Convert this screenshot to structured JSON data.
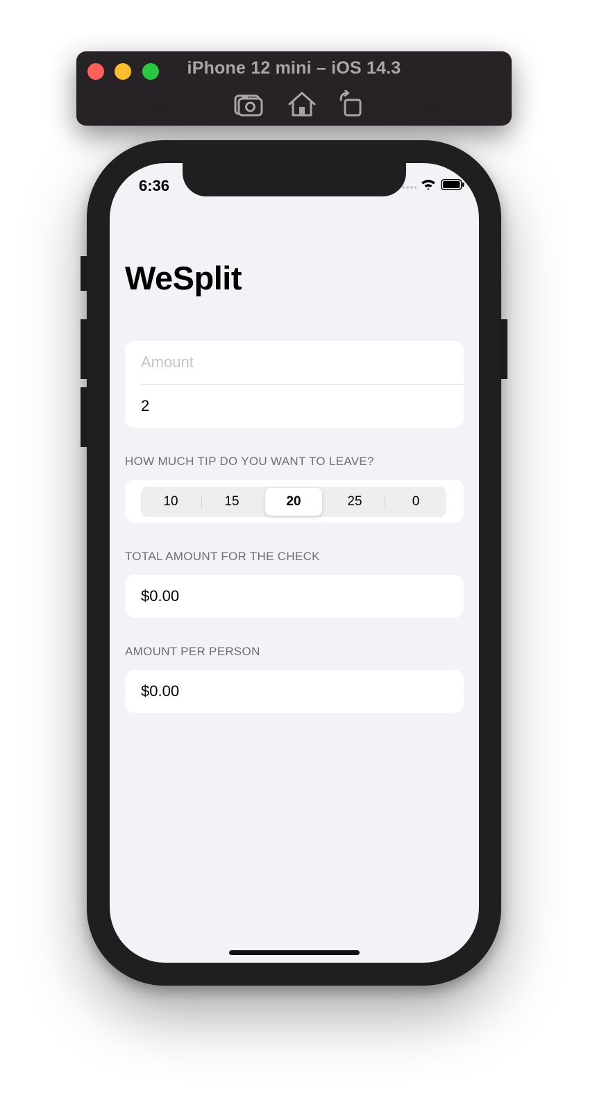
{
  "simulator": {
    "title": "iPhone 12 mini – iOS 14.3",
    "colors": {
      "close": "#fe5f57",
      "minimize": "#febc2e",
      "zoom": "#28c840"
    },
    "toolbar_icons": [
      "screenshot-icon",
      "home-icon",
      "rotate-icon"
    ]
  },
  "status_bar": {
    "time": "6:36"
  },
  "app": {
    "title": "WeSplit",
    "amount_field": {
      "placeholder": "Amount",
      "value": ""
    },
    "people_field": {
      "value": "2"
    },
    "tip_section": {
      "header": "HOW MUCH TIP DO YOU WANT TO LEAVE?",
      "options": [
        "10",
        "15",
        "20",
        "25",
        "0"
      ],
      "selected": "20"
    },
    "total_section": {
      "header": "TOTAL AMOUNT FOR THE CHECK",
      "value": "$0.00"
    },
    "per_person_section": {
      "header": "AMOUNT PER PERSON",
      "value": "$0.00"
    }
  },
  "colors": {
    "background": "#f2f2f7",
    "card": "#ffffff",
    "section_header": "#6e6e73",
    "placeholder": "#c4c4c8"
  }
}
